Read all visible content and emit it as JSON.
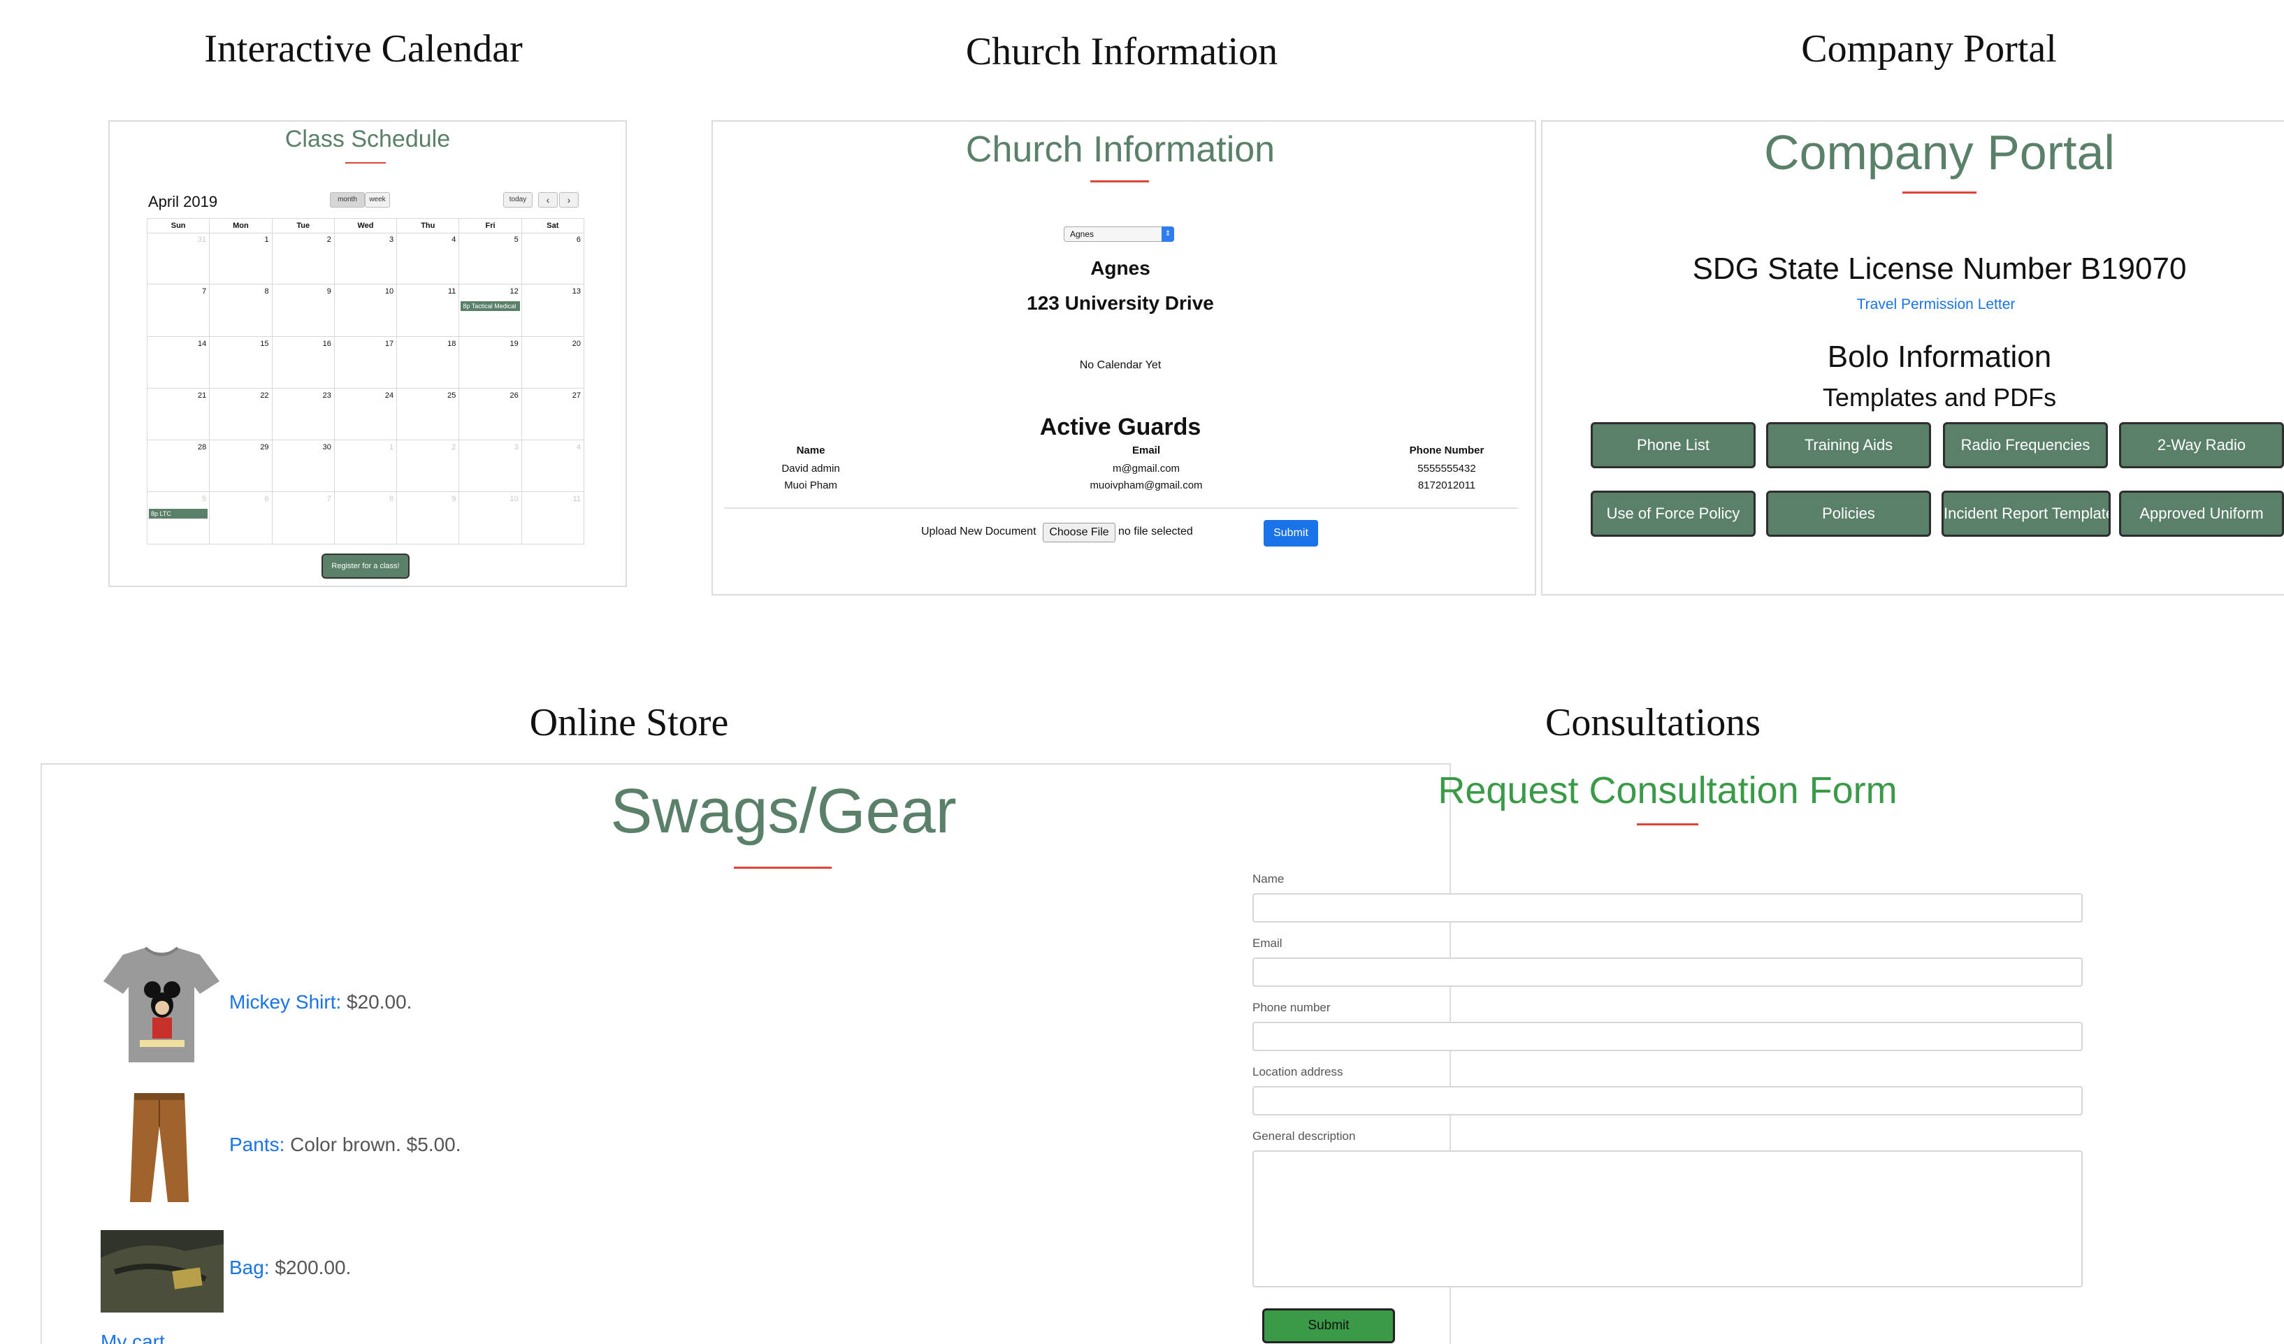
{
  "captions": {
    "calendar": "Interactive Calendar",
    "church": "Church Information",
    "portal": "Company Portal",
    "store": "Online Store",
    "consult": "Consultations"
  },
  "calendar": {
    "title": "Class Schedule",
    "month_label": "April 2019",
    "view_month": "month",
    "view_week": "week",
    "today": "today",
    "prev": "‹",
    "next": "›",
    "days": [
      "Sun",
      "Mon",
      "Tue",
      "Wed",
      "Thu",
      "Fri",
      "Sat"
    ],
    "weeks": [
      [
        "31",
        "1",
        "2",
        "3",
        "4",
        "5",
        "6"
      ],
      [
        "7",
        "8",
        "9",
        "10",
        "11",
        "12",
        "13"
      ],
      [
        "14",
        "15",
        "16",
        "17",
        "18",
        "19",
        "20"
      ],
      [
        "21",
        "22",
        "23",
        "24",
        "25",
        "26",
        "27"
      ],
      [
        "28",
        "29",
        "30",
        "1",
        "2",
        "3",
        "4"
      ],
      [
        "5",
        "6",
        "7",
        "8",
        "9",
        "10",
        "11"
      ]
    ],
    "events": [
      {
        "label": "8p Tactical Medical"
      },
      {
        "label": "8p LTC"
      }
    ],
    "register_label": "Register for a class!"
  },
  "church": {
    "title": "Church Information",
    "select_value": "Agnes",
    "name": "Agnes",
    "address": "123 University Drive",
    "no_calendar": "No Calendar Yet",
    "guards_title": "Active Guards",
    "columns": [
      "Name",
      "Email",
      "Phone Number"
    ],
    "guards": [
      {
        "name": "David admin",
        "email": "m@gmail.com",
        "phone": "5555555432"
      },
      {
        "name": "Muoi Pham",
        "email": "muoivpham@gmail.com",
        "phone": "8172012011"
      }
    ],
    "upload_label": "Upload New Document",
    "choose_file": "Choose File",
    "no_file": "no file selected",
    "submit": "Submit"
  },
  "portal": {
    "title": "Company Portal",
    "license": "SDG State License Number B19070",
    "permission_link": "Travel Permission Letter",
    "bolo": "Bolo Information",
    "templates": "Templates and PDFs",
    "buttons": [
      "Phone List",
      "Training Aids",
      "Radio Frequencies",
      "2-Way Radio",
      "Use of Force Policy",
      "Policies",
      "Incident Report Template",
      "Approved Uniform"
    ]
  },
  "store": {
    "title": "Swags/Gear",
    "items": [
      {
        "name": "Mickey Shirt:",
        "desc": " $20.00."
      },
      {
        "name": "Pants:",
        "desc": " Color brown. $5.00."
      },
      {
        "name": "Bag:",
        "desc": " $200.00."
      }
    ],
    "cart": "My cart"
  },
  "consult": {
    "title": "Request Consultation Form",
    "fields": [
      "Name",
      "Email",
      "Phone number",
      "Location address",
      "General description"
    ],
    "submit": "Submit"
  },
  "colors": {
    "accent_green": "#5a8069",
    "rule_red": "#e0443a",
    "link_blue": "#1a73e8",
    "form_green": "#3a9a48"
  }
}
